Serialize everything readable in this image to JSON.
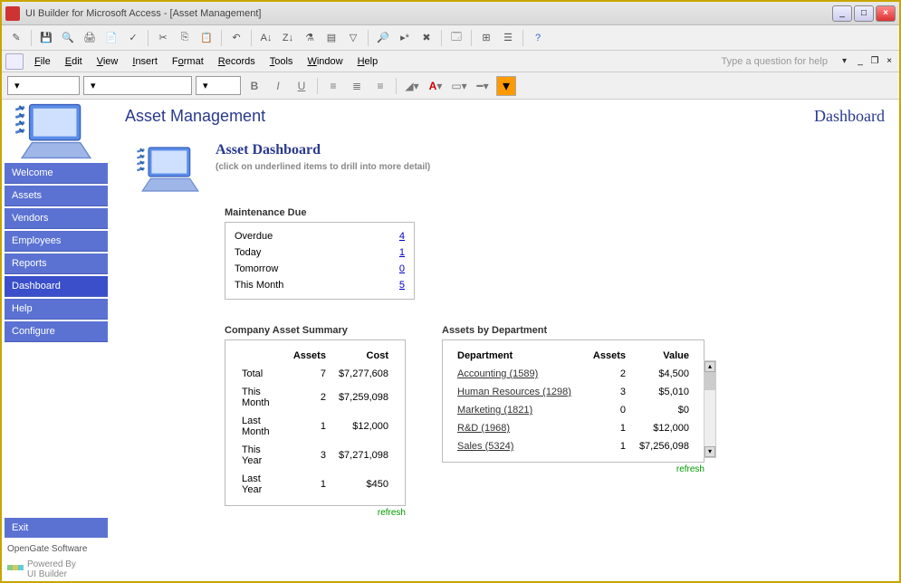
{
  "window": {
    "title": "UI Builder for Microsoft Access - [Asset Management]",
    "minimize": "_",
    "maximize": "□",
    "close": "×"
  },
  "menubar": {
    "items": [
      "File",
      "Edit",
      "View",
      "Insert",
      "Format",
      "Records",
      "Tools",
      "Window",
      "Help"
    ],
    "help_placeholder": "Type a question for help"
  },
  "content": {
    "app_title": "Asset Management",
    "page_name": "Dashboard",
    "dash_title": "Asset Dashboard",
    "dash_hint": "(click on underlined items to drill into more detail)"
  },
  "sidebar": {
    "items": [
      {
        "label": "Welcome"
      },
      {
        "label": "Assets"
      },
      {
        "label": "Vendors"
      },
      {
        "label": "Employees"
      },
      {
        "label": "Reports"
      },
      {
        "label": "Dashboard",
        "active": true
      },
      {
        "label": "Help"
      },
      {
        "label": "Configure"
      }
    ],
    "exit": "Exit",
    "footer": "OpenGate Software",
    "powered1": "Powered By",
    "powered2": "UI Builder"
  },
  "maintenance": {
    "title": "Maintenance Due",
    "rows": [
      {
        "label": "Overdue",
        "value": "4"
      },
      {
        "label": "Today",
        "value": "1"
      },
      {
        "label": "Tomorrow",
        "value": "0"
      },
      {
        "label": "This Month",
        "value": "5"
      }
    ]
  },
  "summary": {
    "title": "Company Asset Summary",
    "headers": {
      "blank": "",
      "assets": "Assets",
      "cost": "Cost"
    },
    "rows": [
      {
        "label": "Total",
        "assets": "7",
        "cost": "$7,277,608"
      },
      {
        "label": "This Month",
        "assets": "2",
        "cost": "$7,259,098"
      },
      {
        "label": "Last Month",
        "assets": "1",
        "cost": "$12,000"
      },
      {
        "label": "This Year",
        "assets": "3",
        "cost": "$7,271,098"
      },
      {
        "label": "Last Year",
        "assets": "1",
        "cost": "$450"
      }
    ],
    "refresh": "refresh"
  },
  "departments": {
    "title": "Assets by Department",
    "headers": {
      "dept": "Department",
      "assets": "Assets",
      "value": "Value"
    },
    "rows": [
      {
        "name": "Accounting (1589)",
        "assets": "2",
        "value": "$4,500"
      },
      {
        "name": "Human Resources (1298)",
        "assets": "3",
        "value": "$5,010"
      },
      {
        "name": "Marketing (1821)",
        "assets": "0",
        "value": "$0"
      },
      {
        "name": "R&D (1968)",
        "assets": "1",
        "value": "$12,000"
      },
      {
        "name": "Sales (5324)",
        "assets": "1",
        "value": "$7,256,098"
      }
    ],
    "refresh": "refresh"
  }
}
